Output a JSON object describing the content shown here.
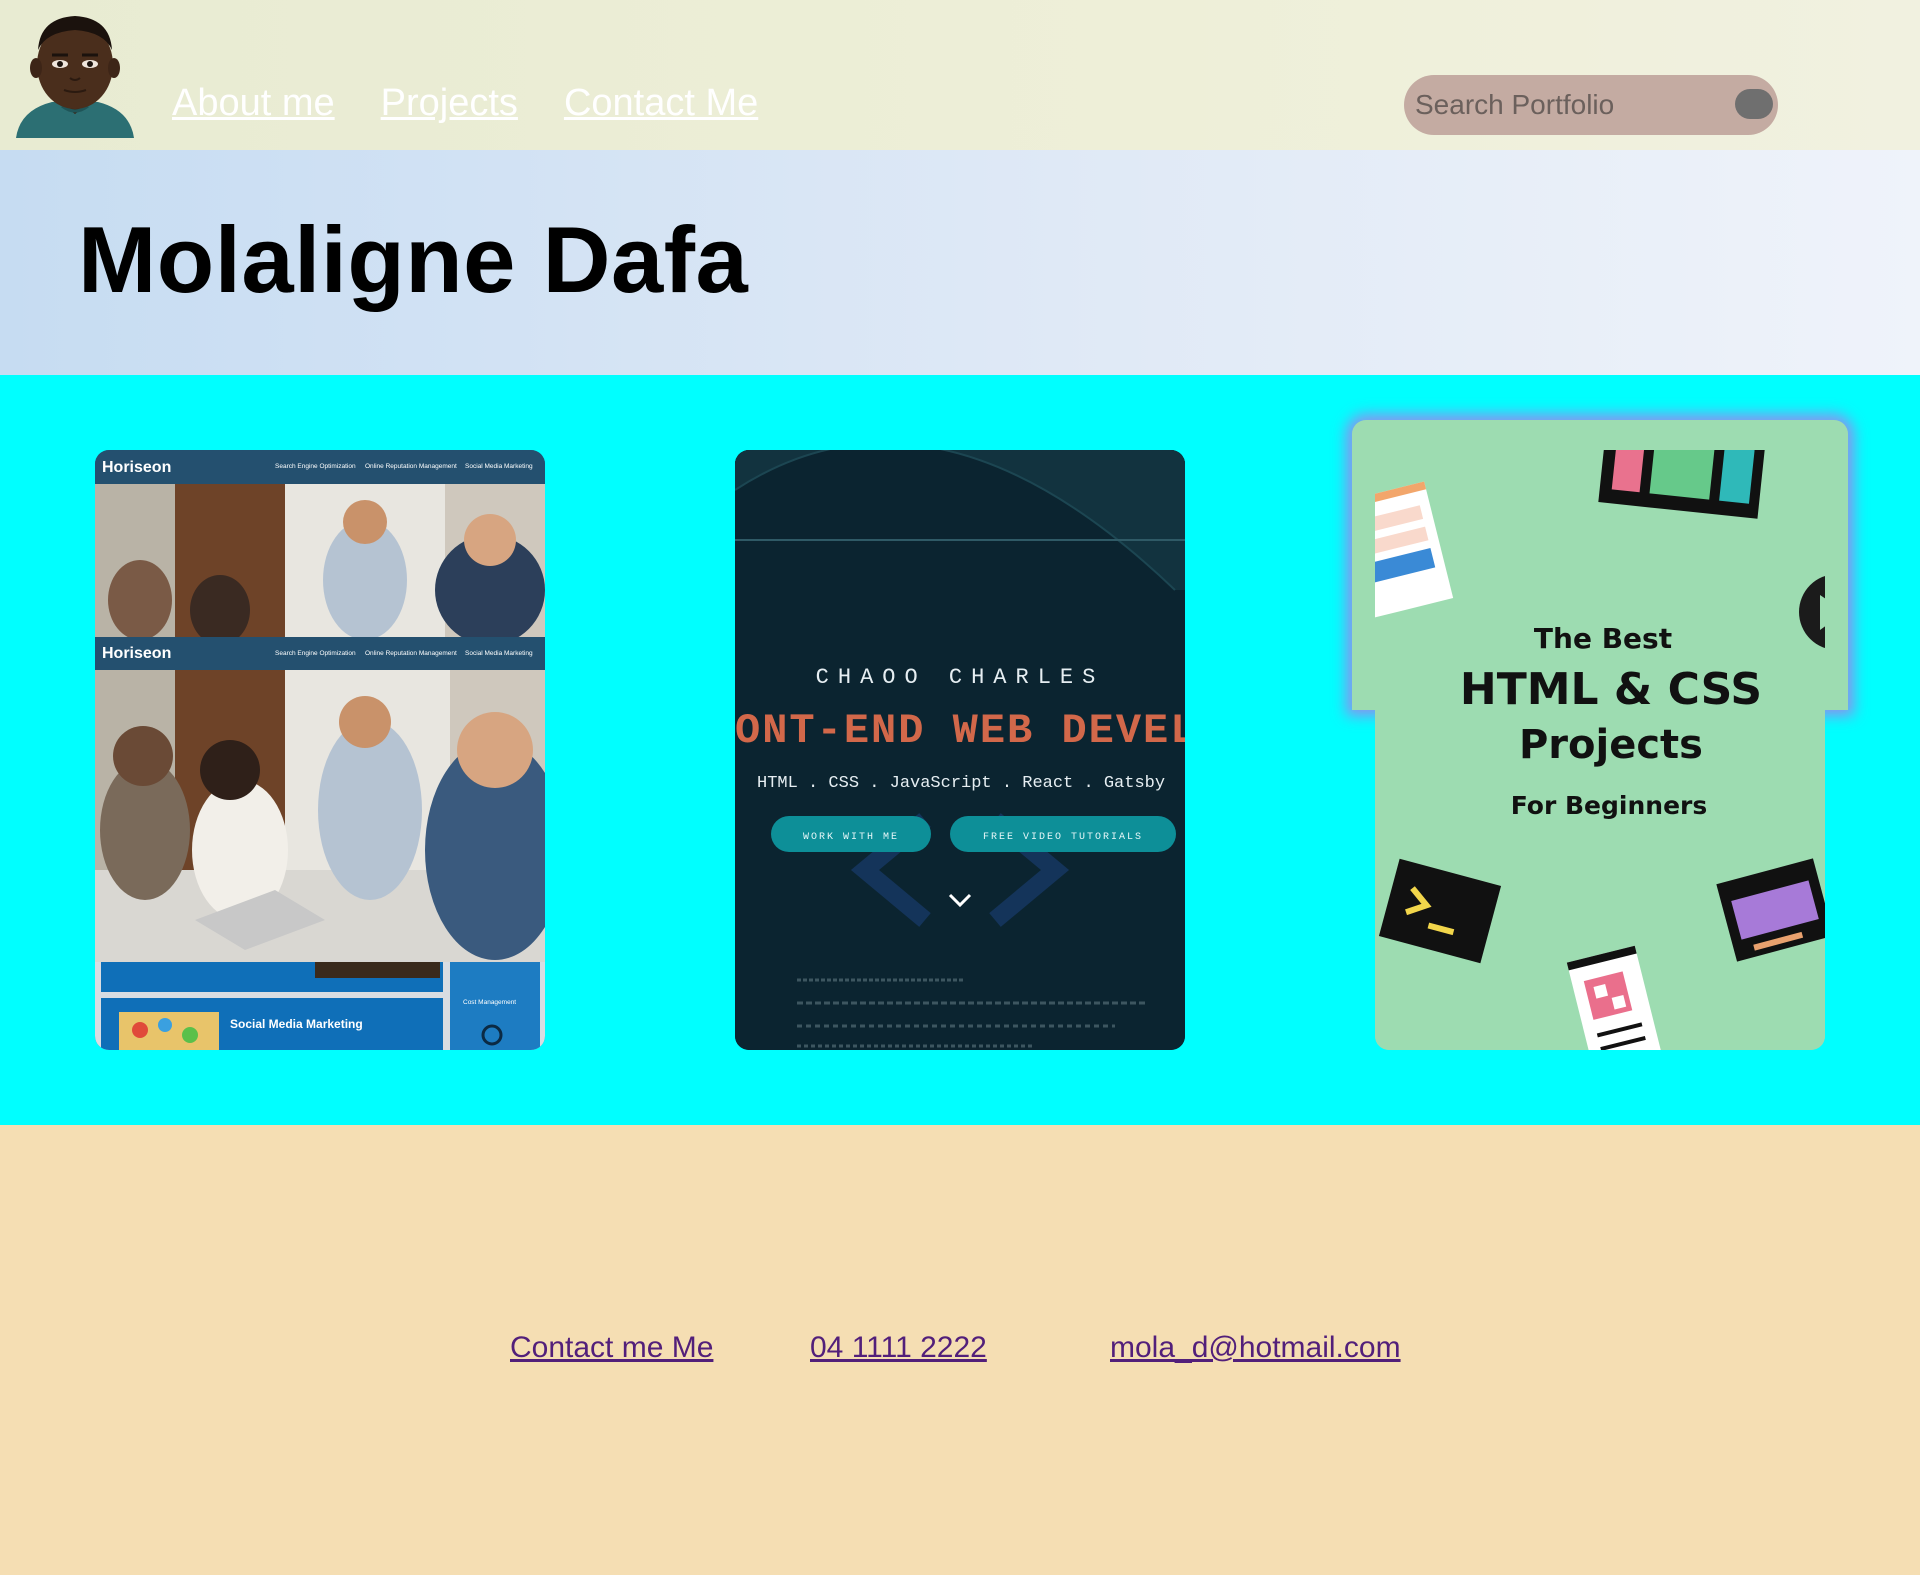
{
  "header": {
    "nav": [
      "About me",
      "Projects",
      "Contact Me"
    ],
    "search_placeholder": "Search Portfolio"
  },
  "hero": {
    "title": "Molaligne Dafa"
  },
  "projects": {
    "card1": {
      "brand": "Horiseon",
      "nav": [
        "Search Engine Optimization",
        "Online Reputation Management",
        "Social Media Marketing"
      ],
      "section": "Social Media Marketing",
      "side_label": "Cost Management"
    },
    "card2": {
      "name": "CHAOO CHARLES",
      "role": "ONT-END WEB DEVELO",
      "skills": "HTML . CSS . JavaScript . React . Gatsby",
      "btn1": "WORK WITH ME",
      "btn2": "FREE VIDEO TUTORIALS"
    },
    "card3": {
      "line1": "The Best",
      "line2": "HTML & CSS",
      "line3": "Projects",
      "line4": "For Beginners"
    }
  },
  "footer": {
    "links": [
      "Contact me Me",
      "04 1111 2222",
      "mola_d@hotmail.com"
    ]
  }
}
